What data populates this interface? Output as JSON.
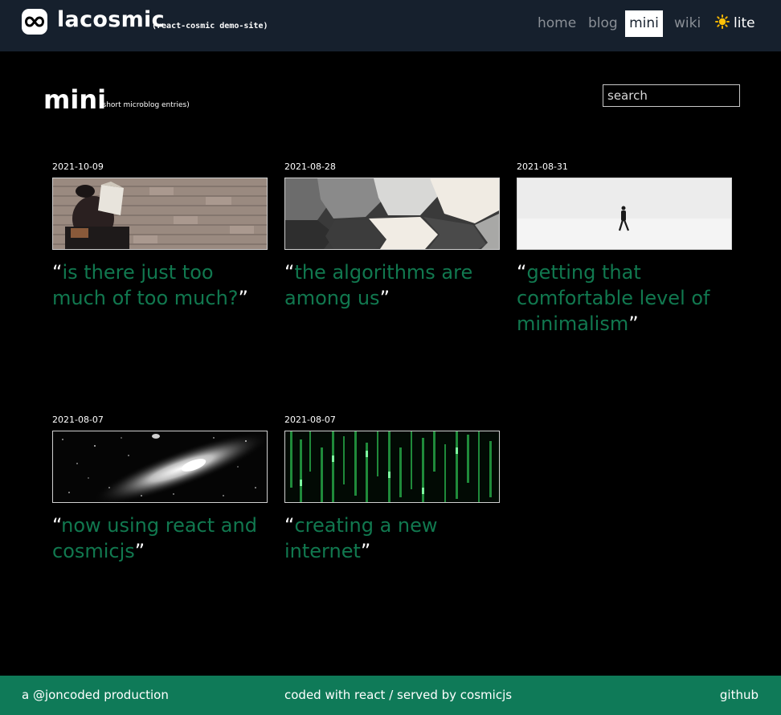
{
  "header": {
    "brand": "lacosmic",
    "brand_sub": "(react-cosmic demo-site)",
    "nav": [
      "home",
      "blog",
      "mini",
      "wiki"
    ],
    "active_nav": "mini",
    "theme_toggle_label": "lite",
    "colors": {
      "bar": "#16202d",
      "nav_inactive": "#8a8f96"
    }
  },
  "page": {
    "title": "mini",
    "subtitle": "(short microblog entries)",
    "search_placeholder": "search"
  },
  "posts": [
    {
      "date": "2021-10-09",
      "open_quote": "“",
      "title": "is there just too much of too much?",
      "close_quote": "”",
      "image": "woman-with-book-against-brick-wall"
    },
    {
      "date": "2021-08-28",
      "open_quote": "“",
      "title": "the algorithms are among us",
      "close_quote": "”",
      "image": "hexagon-floor-tiles"
    },
    {
      "date": "2021-08-31",
      "open_quote": "“",
      "title": "getting that comfortable level of minimalism",
      "close_quote": "”",
      "image": "person-walking-in-white"
    },
    {
      "date": "2021-08-07",
      "open_quote": "“",
      "title": "now using react and cosmicjs",
      "close_quote": "”",
      "image": "galaxy"
    },
    {
      "date": "2021-08-07",
      "open_quote": "“",
      "title": "creating a new internet",
      "close_quote": "”",
      "image": "green-code-rain"
    }
  ],
  "footer": {
    "left": "a @joncoded production",
    "middle": "coded with react / served by cosmicjs",
    "right": "github"
  },
  "colors": {
    "accent": "#11784f",
    "footer": "#0f7a58",
    "background": "#000000"
  }
}
